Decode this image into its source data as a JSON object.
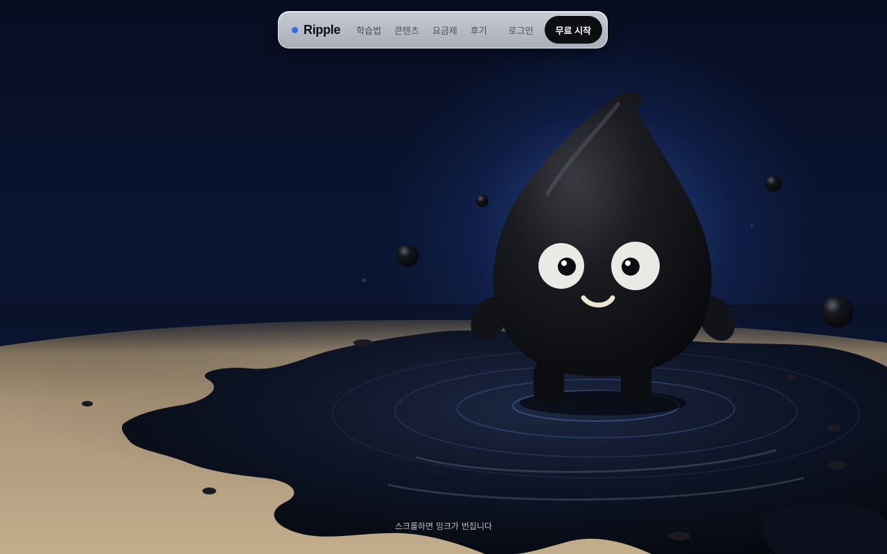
{
  "brand": {
    "name": "Ripple",
    "accent_color": "#2f6cf0"
  },
  "nav": {
    "links": [
      {
        "label": "학습법"
      },
      {
        "label": "콘텐츠"
      },
      {
        "label": "요금제"
      },
      {
        "label": "후기"
      }
    ],
    "login_label": "로그인",
    "cta_label": "무료 시작"
  },
  "hero": {
    "image_subject": "black ink-drop character standing in an ink puddle",
    "scroll_hint": "스크롤하면 잉크가 번집니다"
  },
  "colors": {
    "background": "#070e22",
    "glow": "#3c6ed2",
    "paper": "#b4a080",
    "ink": "#0a0d16",
    "cta_background": "#0d0e12"
  }
}
